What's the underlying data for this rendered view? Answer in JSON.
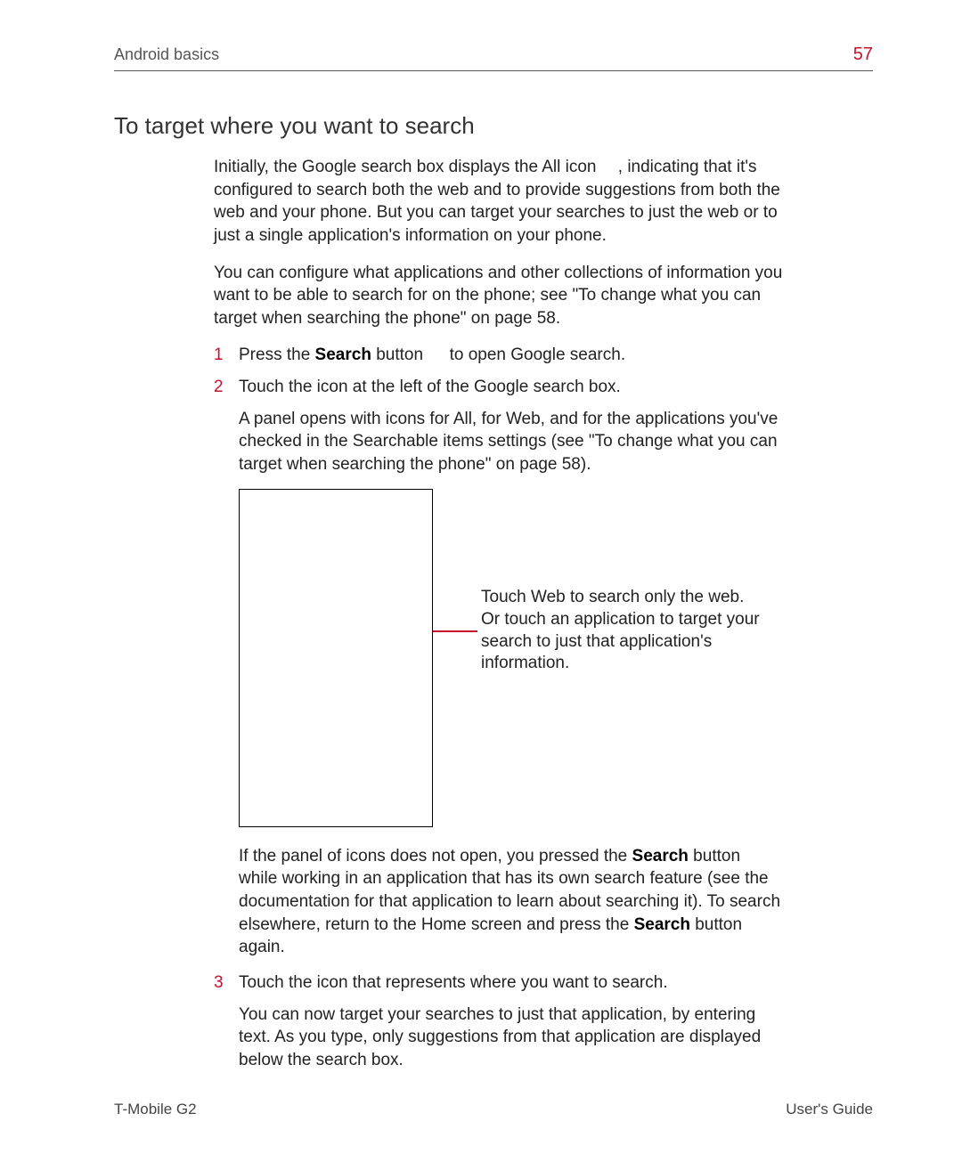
{
  "header": {
    "chapter": "Android basics",
    "page_number": "57"
  },
  "section_title": "To target where you want to search",
  "intro_paragraphs": [
    "Initially, the Google search box displays the All icon  , indicating that it's configured to search both the web and to provide suggestions from both the web and your phone. But you can target your searches to just the web or to just a single application's information on your phone.",
    "You can configure what applications and other collections of information you want to be able to search for on the phone; see \"To change what you can target when searching the phone\" on page 58."
  ],
  "steps": [
    {
      "parts": [
        {
          "t": "text",
          "v": "Press the "
        },
        {
          "t": "strong",
          "v": "Search"
        },
        {
          "t": "text",
          "v": " button   to open Google search."
        }
      ],
      "paragraphs": []
    },
    {
      "parts": [
        {
          "t": "text",
          "v": "Touch the icon at the left of the Google search box."
        }
      ],
      "paragraphs": [
        "A panel opens with icons for All, for Web, and for the applications you've checked in the Searchable items settings (see \"To change what you can target when searching the phone\" on page 58)."
      ],
      "figure": {
        "callout": "Touch Web to search only the web. Or touch an application to target your search to just that application's information."
      },
      "after_figure_parts": [
        {
          "t": "text",
          "v": "If the panel of icons does not open, you pressed the "
        },
        {
          "t": "strong",
          "v": "Search"
        },
        {
          "t": "text",
          "v": " button   while working in an application that has its own search feature (see the documentation for that application to learn about searching it). To search elsewhere, return to the Home screen and press the "
        },
        {
          "t": "strong",
          "v": "Search"
        },
        {
          "t": "text",
          "v": " button   again."
        }
      ]
    },
    {
      "parts": [
        {
          "t": "text",
          "v": "Touch the icon that represents where you want to search."
        }
      ],
      "paragraphs": [
        "You can now target your searches to just that application, by entering text. As you type, only suggestions from that application are displayed below the search box."
      ]
    }
  ],
  "footer": {
    "left": "T-Mobile G2",
    "right": "User's Guide"
  }
}
